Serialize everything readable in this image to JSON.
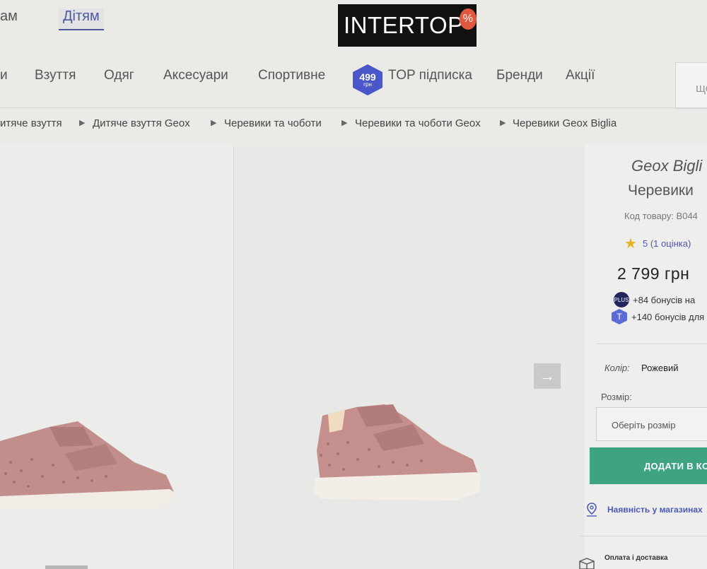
{
  "top_tabs": [
    {
      "label": "ам",
      "active": false
    },
    {
      "label": "Дітям",
      "active": true
    }
  ],
  "logo": {
    "text": "INTERTOP",
    "badge": "%"
  },
  "nav": {
    "items": [
      "и",
      "Взуття",
      "Одяг",
      "Аксесуари",
      "Спортивне"
    ],
    "top_badge": {
      "amount": "499",
      "unit": "грн"
    },
    "top_label": "TOP підписка",
    "items_after": [
      "Бренди",
      "Акції"
    ],
    "search_placeholder": "що"
  },
  "breadcrumb": [
    "итяче взуття",
    "Дитяче взуття Geox",
    "Черевики та чоботи",
    "Черевики та чоботи Geox",
    "Черевики Geox Biglia"
  ],
  "product": {
    "brand": "Geox Bigli",
    "type": "Черевики",
    "code": "Код товару: B044",
    "rating": "5 (1 оцінка)",
    "price": "2 799 грн",
    "bonus_plus": {
      "icon": "PLUS",
      "text": "+84 бонусів на"
    },
    "bonus_top": {
      "icon": "T",
      "text": "+140 бонусів для"
    },
    "color_label": "Колір:",
    "color_value": "Рожевий",
    "size_label": "Розмір:",
    "size_placeholder": "Оберіть розмір",
    "add_button": "ДОДАТИ В КО",
    "stores_link": "Наявність у магазинах",
    "delivery": "Оплата і доставка"
  },
  "colors": {
    "accent": "#4b5a9a",
    "button": "#3ea383",
    "badge": "#4a57c9",
    "shoe": "#c08b8b"
  },
  "icons": {
    "next": "arrow-right-icon",
    "star": "star-icon",
    "pin": "location-pin-icon",
    "box": "box-icon"
  }
}
